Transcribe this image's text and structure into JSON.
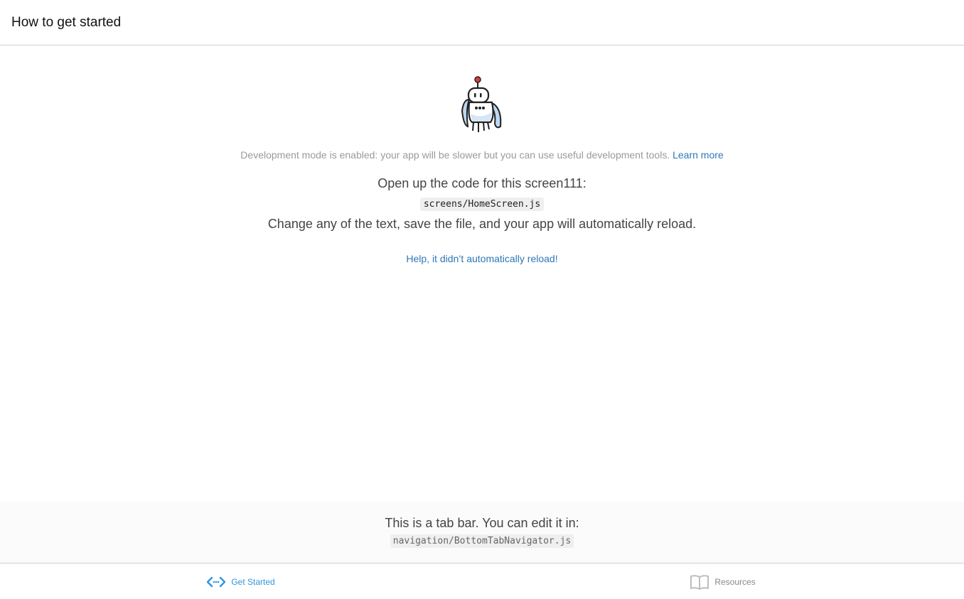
{
  "header": {
    "title": "How to get started"
  },
  "main": {
    "dev_note": "Development mode is enabled: your app will be slower but you can use useful development tools. ",
    "learn_more": "Learn more",
    "open_text": "Open up the code for this screen111:",
    "code_path": "screens/HomeScreen.js",
    "change_text": "Change any of the text, save the file, and your app will automatically reload.",
    "help_link": "Help, it didn’t automatically reload!"
  },
  "tab_info": {
    "text": "This is a tab bar. You can edit it in:",
    "code_path": "navigation/BottomTabNavigator.js"
  },
  "tabs": [
    {
      "label": "Get Started",
      "icon": "code-icon",
      "active": true
    },
    {
      "label": "Resources",
      "icon": "book-icon",
      "active": false
    }
  ],
  "colors": {
    "active_tab": "#2f95dc",
    "link": "#2e78b7",
    "inactive_tab": "#bdbdbd"
  }
}
